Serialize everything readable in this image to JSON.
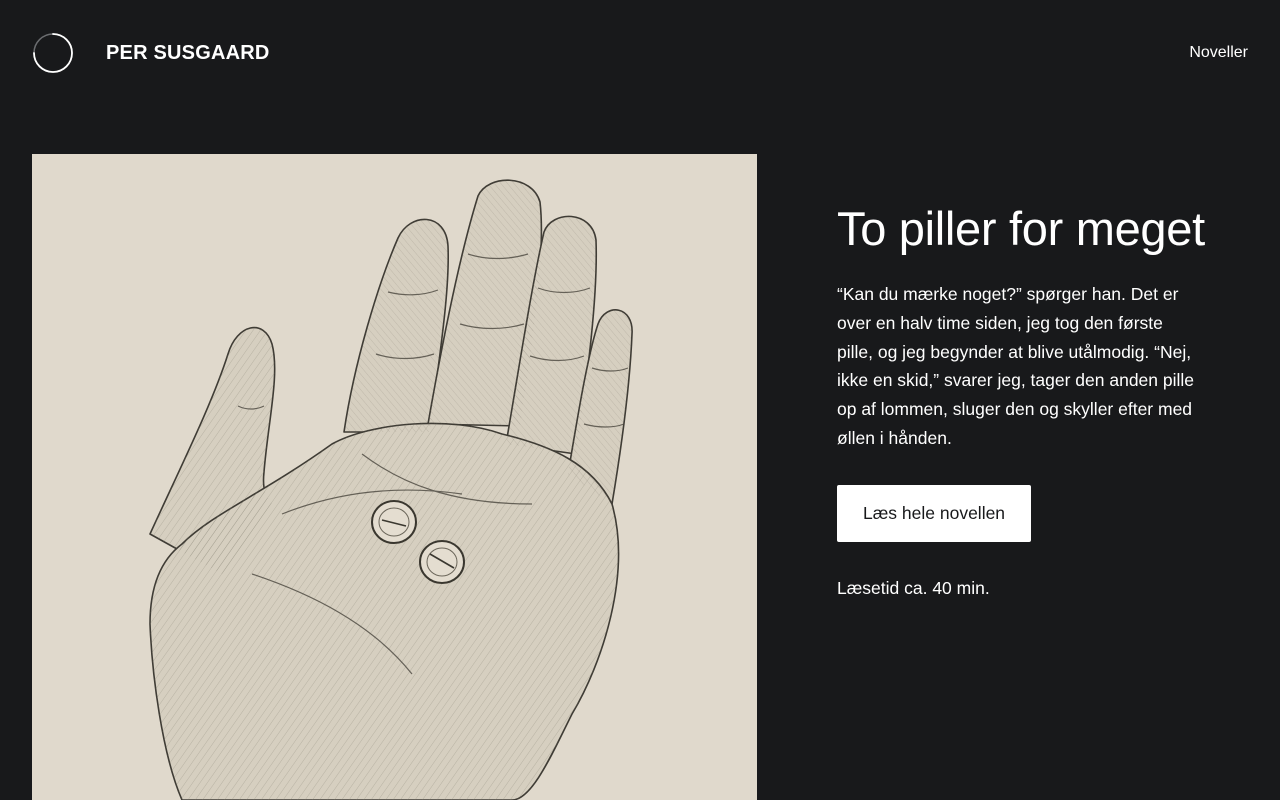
{
  "header": {
    "logo_icon": "circle-logo-icon",
    "site_title": "PER SUSGAARD",
    "nav_link": "Noveller"
  },
  "illustration": {
    "subject": "pencil-sketch-hand-holding-two-pills",
    "background_color": "#e0d9cc"
  },
  "story": {
    "title": "To piller for meget",
    "excerpt": "“Kan du mærke noget?” spørger han. Det er over en halv time siden, jeg tog den første pille, og jeg begynder at blive utålmodig. “Nej, ikke en skid,” svarer jeg, tager den anden pille op af lommen, sluger den og skyller efter med øllen i hånden.",
    "button_label": "Læs hele novellen",
    "reading_time": "Læsetid ca. 40 min."
  },
  "colors": {
    "page_background": "#18191b",
    "text": "#ffffff",
    "button_background": "#ffffff",
    "button_text": "#18191b"
  }
}
